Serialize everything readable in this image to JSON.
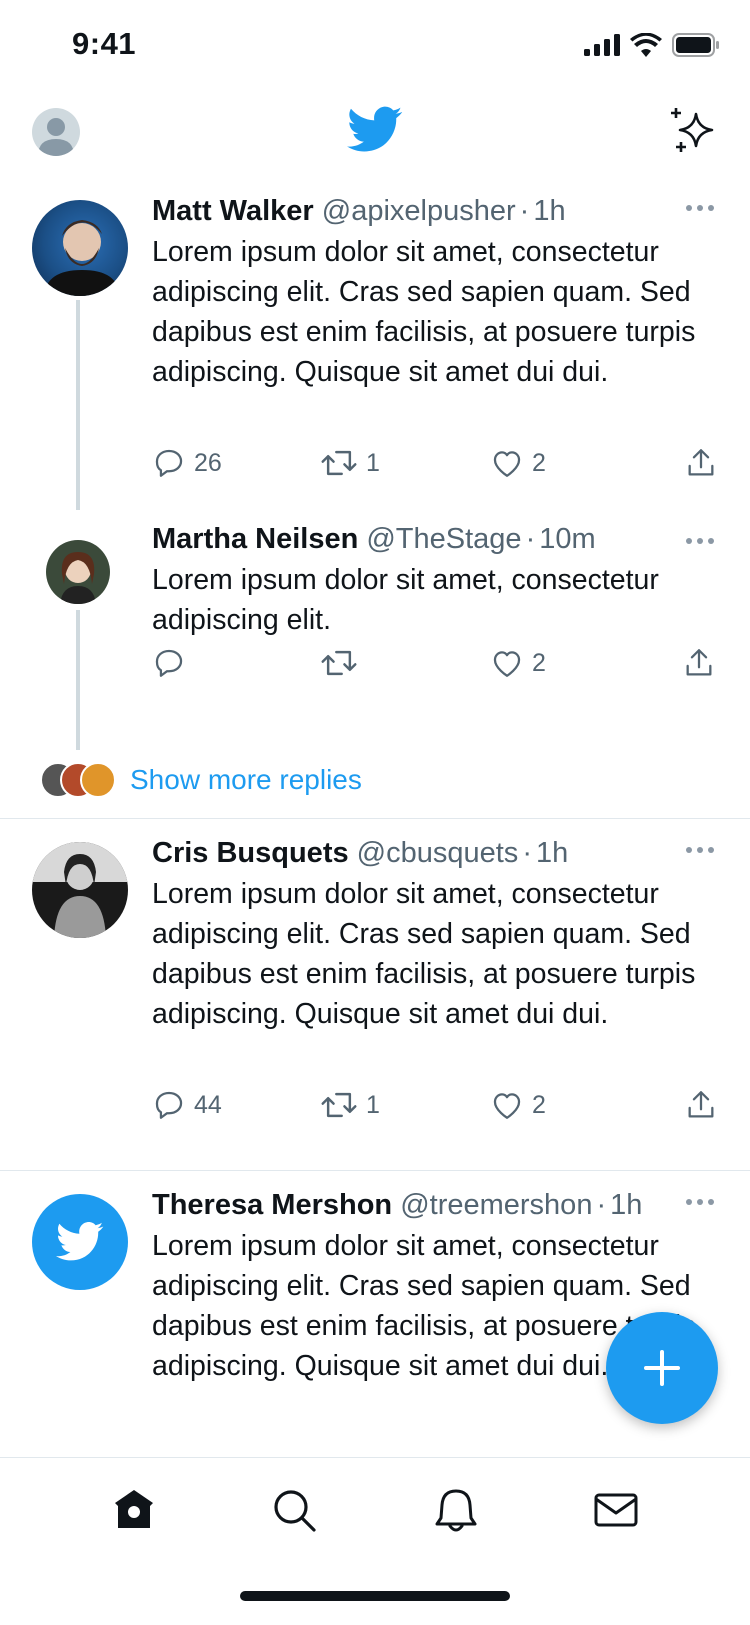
{
  "status_bar": {
    "time": "9:41"
  },
  "colors": {
    "accent": "#1d9bf0",
    "text": "#0f1419",
    "secondary": "#536471"
  },
  "header": {
    "logo_icon": "twitter-bird-icon",
    "sparkle_icon": "sparkle-icon",
    "profile_icon": "profile-avatar"
  },
  "tweets": [
    {
      "name": "Matt Walker",
      "handle": "@apixelpusher",
      "separator": "·",
      "time": "1h",
      "text": "Lorem ipsum dolor sit amet, consectetur adipiscing elit. Cras sed sapien quam. Sed dapibus est enim facilisis, at posuere turpis adipiscing. Quisque sit amet dui dui.",
      "replies": "26",
      "retweets": "1",
      "likes": "2"
    },
    {
      "name": "Martha Neilsen",
      "handle": "@TheStage",
      "separator": "·",
      "time": "10m",
      "text": "Lorem ipsum dolor sit amet, consectetur adipiscing elit.",
      "replies": "",
      "retweets": "",
      "likes": "2"
    },
    {
      "name": "Cris Busquets",
      "handle": "@cbusquets",
      "separator": "·",
      "time": "1h",
      "text": "Lorem ipsum dolor sit amet, consectetur adipiscing elit. Cras sed sapien quam. Sed dapibus est enim facilisis, at posuere turpis adipiscing. Quisque sit amet dui dui.",
      "replies": "44",
      "retweets": "1",
      "likes": "2"
    },
    {
      "name": "Theresa Mershon",
      "handle": "@treemershon",
      "separator": "·",
      "time": "1h",
      "text": "Lorem ipsum dolor sit amet, consectetur adipiscing elit. Cras sed sapien quam. Sed dapibus est enim facilisis, at posuere turpis adipiscing. Quisque sit amet dui dui."
    }
  ],
  "thread": {
    "show_more_label": "Show more replies"
  },
  "tabs": [
    "home-icon",
    "search-icon",
    "notifications-icon",
    "messages-icon"
  ],
  "fab": {
    "icon": "plus-icon"
  }
}
